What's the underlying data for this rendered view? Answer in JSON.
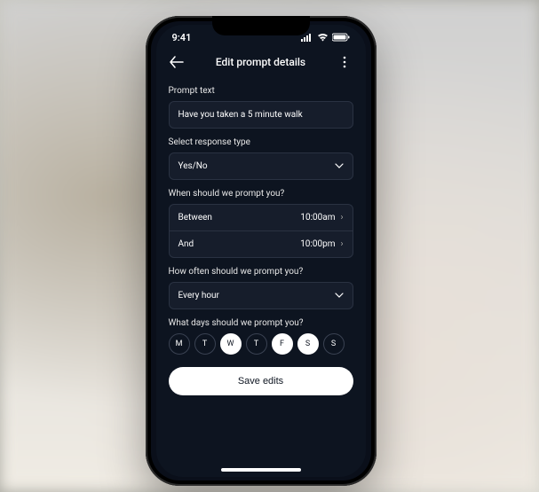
{
  "status": {
    "time": "9:41"
  },
  "header": {
    "title": "Edit prompt details"
  },
  "prompt": {
    "label": "Prompt text",
    "value": "Have you taken a 5 minute walk"
  },
  "response": {
    "label": "Select response type",
    "value": "Yes/No"
  },
  "schedule": {
    "label": "When should we prompt you?",
    "between_label": "Between",
    "between_value": "10:00am",
    "and_label": "And",
    "and_value": "10:00pm"
  },
  "frequency": {
    "label": "How often should we prompt you?",
    "value": "Every hour"
  },
  "days": {
    "label": "What days should we prompt you?",
    "items": [
      {
        "letter": "M",
        "selected": false
      },
      {
        "letter": "T",
        "selected": false
      },
      {
        "letter": "W",
        "selected": true
      },
      {
        "letter": "T",
        "selected": false
      },
      {
        "letter": "F",
        "selected": true
      },
      {
        "letter": "S",
        "selected": true
      },
      {
        "letter": "S",
        "selected": false
      }
    ]
  },
  "actions": {
    "save": "Save edits"
  }
}
